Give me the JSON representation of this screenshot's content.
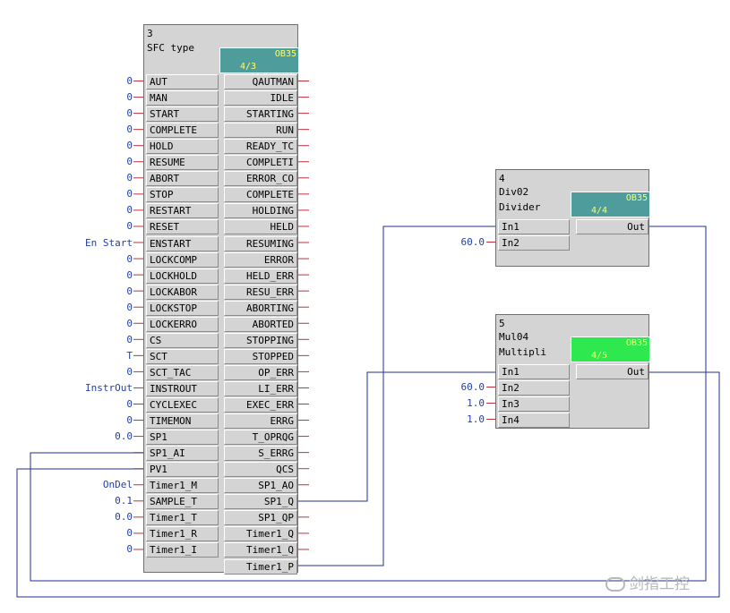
{
  "blocks": {
    "sfc": {
      "number": "3",
      "name": "SFC type",
      "ob": "OB35",
      "ob_seq": "4/3",
      "ob_color": "#4f9c9c",
      "inputs": [
        {
          "pin": "AUT",
          "value": "0"
        },
        {
          "pin": "MAN",
          "value": "0"
        },
        {
          "pin": "START",
          "value": "0"
        },
        {
          "pin": "COMPLETE",
          "value": "0"
        },
        {
          "pin": "HOLD",
          "value": "0"
        },
        {
          "pin": "RESUME",
          "value": "0"
        },
        {
          "pin": "ABORT",
          "value": "0"
        },
        {
          "pin": "STOP",
          "value": "0"
        },
        {
          "pin": "RESTART",
          "value": "0"
        },
        {
          "pin": "RESET",
          "value": "0"
        },
        {
          "pin": "ENSTART",
          "value": "En Start"
        },
        {
          "pin": "LOCKCOMP",
          "value": "0"
        },
        {
          "pin": "LOCKHOLD",
          "value": "0"
        },
        {
          "pin": "LOCKABOR",
          "value": "0"
        },
        {
          "pin": "LOCKSTOP",
          "value": "0"
        },
        {
          "pin": "LOCKERRO",
          "value": "0"
        },
        {
          "pin": "CS",
          "value": "0"
        },
        {
          "pin": "SCT",
          "value": "T"
        },
        {
          "pin": "SCT_TAC",
          "value": "0"
        },
        {
          "pin": "INSTROUT",
          "value": "InstrOut"
        },
        {
          "pin": "CYCLEXEC",
          "value": "0"
        },
        {
          "pin": "TIMEMON",
          "value": "0"
        },
        {
          "pin": "SP1",
          "value": "0.0"
        },
        {
          "pin": "SP1_AI",
          "value": ""
        },
        {
          "pin": "PV1",
          "value": ""
        },
        {
          "pin": "Timer1_M",
          "value": "OnDel"
        },
        {
          "pin": "SAMPLE_T",
          "value": "0.1"
        },
        {
          "pin": "Timer1_T",
          "value": "0.0"
        },
        {
          "pin": "Timer1_R",
          "value": "0"
        },
        {
          "pin": "Timer1_I",
          "value": "0"
        }
      ],
      "outputs": [
        "QAUTMAN",
        "IDLE",
        "STARTING",
        "RUN",
        "READY_TC",
        "COMPLETI",
        "ERROR_CO",
        "COMPLETE",
        "HOLDING",
        "HELD",
        "RESUMING",
        "ERROR",
        "HELD_ERR",
        "RESU_ERR",
        "ABORTING",
        "ABORTED",
        "STOPPING",
        "STOPPED",
        "OP_ERR",
        "LI_ERR",
        "EXEC_ERR",
        "ERRG",
        "T_OPRQG",
        "S_ERRG",
        "QCS",
        "SP1_AO",
        "SP1_Q",
        "SP1_QP",
        "Timer1_Q",
        "Timer1_Q",
        "Timer1_P"
      ]
    },
    "div": {
      "number": "4",
      "name": "Div02",
      "type": "Divider",
      "ob": "OB35",
      "ob_seq": "4/4",
      "ob_color": "#4f9c9c",
      "inputs": [
        {
          "pin": "In1",
          "value": ""
        },
        {
          "pin": "In2",
          "value": "60.0"
        }
      ],
      "outputs": [
        "Out"
      ]
    },
    "mul": {
      "number": "5",
      "name": "Mul04",
      "type": "Multipli",
      "ob": "OB35",
      "ob_seq": "4/5",
      "ob_color": "#2ee84f",
      "inputs": [
        {
          "pin": "In1",
          "value": ""
        },
        {
          "pin": "In2",
          "value": "60.0"
        },
        {
          "pin": "In3",
          "value": "1.0"
        },
        {
          "pin": "In4",
          "value": "1.0"
        }
      ],
      "outputs": [
        "Out"
      ]
    }
  },
  "watermark": "剑指工控",
  "colors": {
    "wire": "#1f2f8f",
    "value": "#1f3fa8",
    "pin_stub": "#c0303a"
  }
}
